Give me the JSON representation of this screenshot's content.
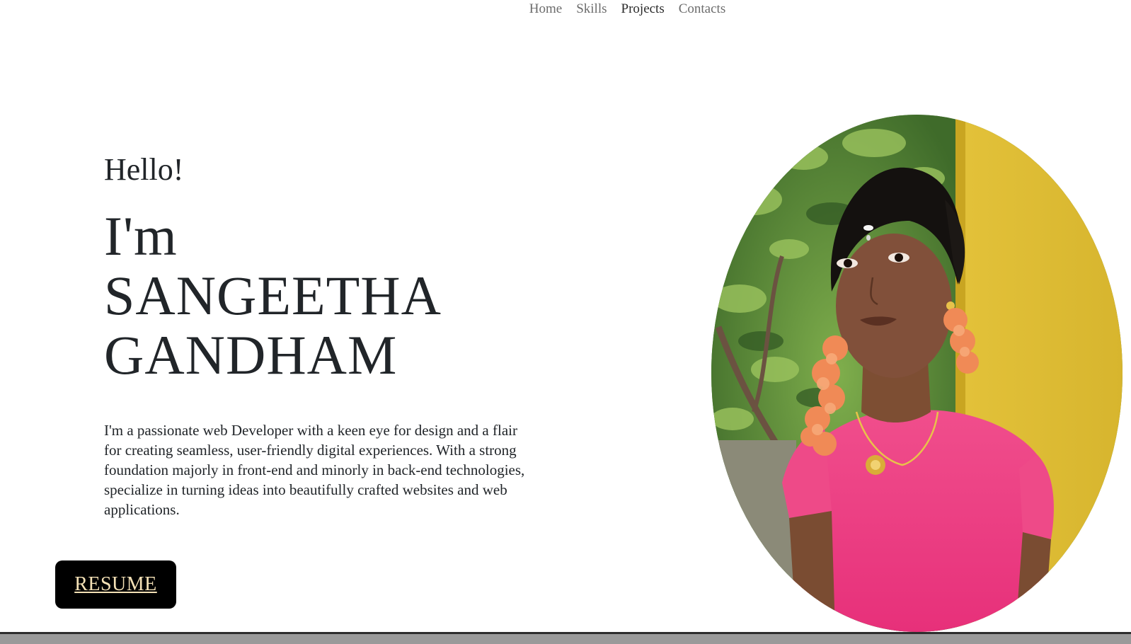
{
  "nav": {
    "items": [
      {
        "label": "Home"
      },
      {
        "label": "Skills"
      },
      {
        "label": "Projects"
      },
      {
        "label": "Contacts"
      }
    ]
  },
  "hero": {
    "greeting": "Hello!",
    "name_lines": [
      "I'm",
      "SANGEETHA",
      "GANDHAM"
    ],
    "bio": "I'm a passionate web Developer with a keen eye for design and a flair for creating seamless, user-friendly digital experiences. With a strong foundation majorly in front-end and minorly in back-end technologies, specialize in turning ideas into beautifully crafted websites and web applications.",
    "resume_label": "RESUME"
  },
  "colors": {
    "text": "#212529",
    "button_bg": "#000000",
    "button_text": "#f4e1b6"
  }
}
